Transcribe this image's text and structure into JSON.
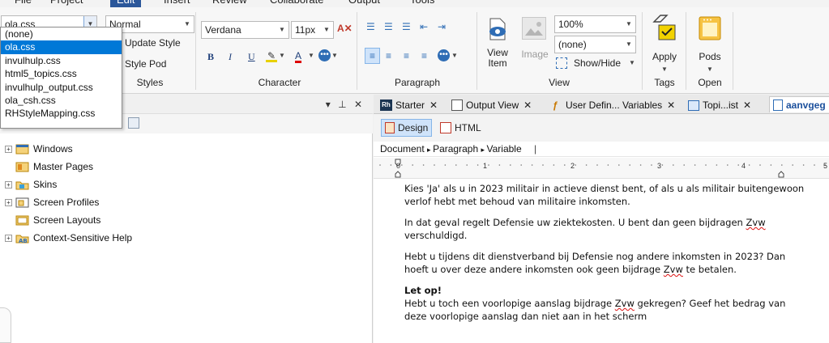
{
  "menubar": {
    "items": [
      "File",
      "Project",
      "Edit",
      "Insert",
      "Review",
      "Collaborate",
      "Output",
      "Tools"
    ],
    "active": "Edit"
  },
  "styles_group": {
    "stylesheet_value": "ola.css",
    "style_value": "Normal",
    "update_style_label": "Update Style",
    "style_pod_label": "Style Pod",
    "label": "Styles"
  },
  "stylesheet_dropdown": {
    "options": [
      "(none)",
      "ola.css",
      "invulhulp.css",
      "html5_topics.css",
      "invulhulp_output.css",
      "ola_csh.css",
      "RHStyleMapping.css"
    ],
    "selected_index": 1
  },
  "character_group": {
    "font_value": "Verdana",
    "size_value": "11px",
    "bold": "B",
    "italic": "I",
    "underline": "U",
    "label": "Character"
  },
  "paragraph_group": {
    "label": "Paragraph"
  },
  "view_group": {
    "view_item_label": "View\nItem",
    "image_label": "Image",
    "zoom_value": "100%",
    "none_value": "(none)",
    "show_hide_label": "Show/Hide",
    "label": "View"
  },
  "tags_group": {
    "apply_label": "Apply",
    "label": "Tags"
  },
  "open_group": {
    "pods_label": "Pods",
    "label": "Open"
  },
  "left_pane": {
    "tree": [
      {
        "label": "Windows",
        "expander": "+"
      },
      {
        "label": "Master Pages",
        "expander": ""
      },
      {
        "label": "Skins",
        "expander": "+"
      },
      {
        "label": "Screen Profiles",
        "expander": "+"
      },
      {
        "label": "Screen Layouts",
        "expander": ""
      },
      {
        "label": "Context-Sensitive Help",
        "expander": "+"
      }
    ],
    "pin_glyph": "▾ ⊥ ✕"
  },
  "tabs": [
    {
      "label": "Starter"
    },
    {
      "label": "Output View"
    },
    {
      "label": "User Defin... Variables"
    },
    {
      "label": "Topi...ist"
    },
    {
      "label": "aanvgeg"
    }
  ],
  "view_tabs": {
    "design": "Design",
    "html": "HTML"
  },
  "breadcrumbs": [
    "Document",
    "Paragraph",
    "Variable"
  ],
  "ruler_numbers": [
    "0",
    "1",
    "2",
    "3",
    "4",
    "5"
  ],
  "content": {
    "p1": "Kies 'Ja' als u in 2023 militair in actieve dienst bent, of als u als militair buitengewoon verlof hebt met behoud van militaire inkomsten.",
    "p2_a": "In dat geval regelt Defensie uw ziektekosten. U bent dan geen bijdragen ",
    "p2_b": "Zvw",
    "p2_c": " verschuldigd.",
    "p3_a": "Hebt u tijdens dit dienstverband bij Defensie nog andere inkomsten in 2023? Dan hoeft u over deze andere inkomsten ook geen bijdrage ",
    "p3_b": "Zvw",
    "p3_c": " te betalen.",
    "heading": "Let op!",
    "p4_a": "Hebt u toch een voorlopige aanslag bijdrage ",
    "p4_b": "Zvw",
    "p4_c": " gekregen? Geef het bedrag van deze voorlopige aanslag dan niet aan in het scherm"
  },
  "colors": {
    "accent": "#2b579a",
    "selection": "#0078d7",
    "tab_active_text": "#1a4f9c"
  }
}
